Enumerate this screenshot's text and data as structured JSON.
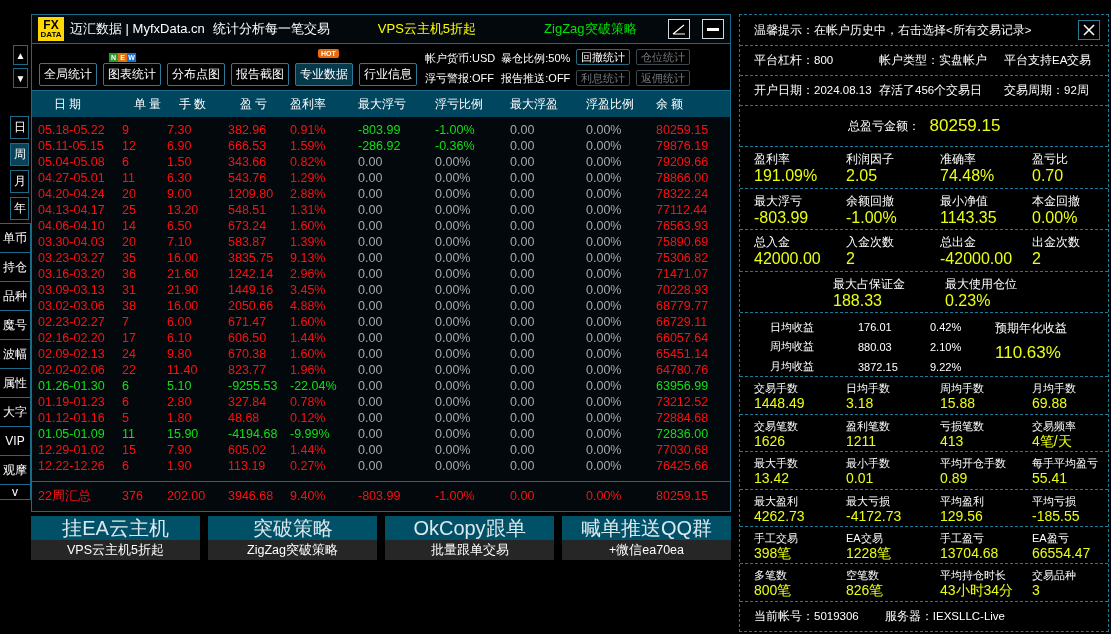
{
  "header": {
    "logo_top": "FX",
    "logo_bottom": "DATA",
    "title": "迈汇数据 | MyfxData.cn",
    "slogan": "统计分析每一笔交易",
    "promo_1": "VPS云主机5折起",
    "promo_2": "ZigZag突破策略"
  },
  "scroll_buttons": [
    "▲",
    "▼"
  ],
  "period_tabs": [
    {
      "label": "日",
      "selected": false
    },
    {
      "label": "周",
      "selected": true
    },
    {
      "label": "月",
      "selected": false
    },
    {
      "label": "年",
      "selected": false
    }
  ],
  "side_menu": [
    "单币",
    "持仓",
    "品种",
    "魔号",
    "波幅",
    "属性",
    "大字",
    "VIP",
    "观摩",
    "v"
  ],
  "toolbar": [
    {
      "label": "全局统计",
      "selected": false
    },
    {
      "label": "图表统计",
      "selected": false,
      "badge": {
        "kind": "new",
        "letters": [
          "N",
          "E",
          "W"
        ]
      }
    },
    {
      "label": "分布点图",
      "selected": false
    },
    {
      "label": "报告截图",
      "selected": false
    },
    {
      "label": "专业数据",
      "selected": true,
      "badge": {
        "kind": "hot",
        "text": "HOT"
      }
    },
    {
      "label": "行业信息",
      "selected": false
    }
  ],
  "account_info": [
    "帐户货币:USD",
    "暴仓比例:50%",
    "浮亏警报:OFF",
    "报告推送:OFF"
  ],
  "stat_buttons": [
    {
      "label": "回撤统计",
      "disabled": false
    },
    {
      "label": "仓位统计",
      "disabled": true
    },
    {
      "label": "利息统计",
      "disabled": true
    },
    {
      "label": "返佣统计",
      "disabled": true
    }
  ],
  "table": {
    "columns": [
      "日 期",
      "单 量",
      "手 数",
      "盈 亏",
      "盈利率",
      "最大浮亏",
      "浮亏比例",
      "最大浮盈",
      "浮盈比例",
      "余 额"
    ],
    "rows": [
      {
        "profit": true,
        "float_drawdown": true,
        "cells": [
          "05.18-05.22",
          "9",
          "7.30",
          "382.96",
          "0.91%",
          "-803.99",
          "-1.00%",
          "0.00",
          "0.00%",
          "80259.15"
        ]
      },
      {
        "profit": true,
        "float_drawdown": true,
        "cells": [
          "05.11-05.15",
          "12",
          "6.90",
          "666.53",
          "1.59%",
          "-286.92",
          "-0.36%",
          "0.00",
          "0.00%",
          "79876.19"
        ]
      },
      {
        "profit": true,
        "float_drawdown": false,
        "cells": [
          "05.04-05.08",
          "6",
          "1.50",
          "343.66",
          "0.82%",
          "0.00",
          "0.00%",
          "0.00",
          "0.00%",
          "79209.66"
        ]
      },
      {
        "profit": true,
        "float_drawdown": false,
        "cells": [
          "04.27-05.01",
          "11",
          "6.30",
          "543.76",
          "1.29%",
          "0.00",
          "0.00%",
          "0.00",
          "0.00%",
          "78866.00"
        ]
      },
      {
        "profit": true,
        "float_drawdown": false,
        "cells": [
          "04.20-04.24",
          "20",
          "9.00",
          "1209.80",
          "2.88%",
          "0.00",
          "0.00%",
          "0.00",
          "0.00%",
          "78322.24"
        ]
      },
      {
        "profit": true,
        "float_drawdown": false,
        "cells": [
          "04.13-04.17",
          "25",
          "13.20",
          "548.51",
          "1.31%",
          "0.00",
          "0.00%",
          "0.00",
          "0.00%",
          "77112.44"
        ]
      },
      {
        "profit": true,
        "float_drawdown": false,
        "cells": [
          "04.06-04.10",
          "14",
          "6.50",
          "673.24",
          "1.60%",
          "0.00",
          "0.00%",
          "0.00",
          "0.00%",
          "76563.93"
        ]
      },
      {
        "profit": true,
        "float_drawdown": false,
        "cells": [
          "03.30-04.03",
          "20",
          "7.10",
          "583.87",
          "1.39%",
          "0.00",
          "0.00%",
          "0.00",
          "0.00%",
          "75890.69"
        ]
      },
      {
        "profit": true,
        "float_drawdown": false,
        "cells": [
          "03.23-03.27",
          "35",
          "16.00",
          "3835.75",
          "9.13%",
          "0.00",
          "0.00%",
          "0.00",
          "0.00%",
          "75306.82"
        ]
      },
      {
        "profit": true,
        "float_drawdown": false,
        "cells": [
          "03.16-03.20",
          "36",
          "21.60",
          "1242.14",
          "2.96%",
          "0.00",
          "0.00%",
          "0.00",
          "0.00%",
          "71471.07"
        ]
      },
      {
        "profit": true,
        "float_drawdown": false,
        "cells": [
          "03.09-03.13",
          "31",
          "21.90",
          "1449.16",
          "3.45%",
          "0.00",
          "0.00%",
          "0.00",
          "0.00%",
          "70228.93"
        ]
      },
      {
        "profit": true,
        "float_drawdown": false,
        "cells": [
          "03.02-03.06",
          "38",
          "16.00",
          "2050.66",
          "4.88%",
          "0.00",
          "0.00%",
          "0.00",
          "0.00%",
          "68779.77"
        ]
      },
      {
        "profit": true,
        "float_drawdown": false,
        "cells": [
          "02.23-02.27",
          "7",
          "6.00",
          "671.47",
          "1.60%",
          "0.00",
          "0.00%",
          "0.00",
          "0.00%",
          "66729.11"
        ]
      },
      {
        "profit": true,
        "float_drawdown": false,
        "cells": [
          "02.16-02.20",
          "17",
          "6.10",
          "606.50",
          "1.44%",
          "0.00",
          "0.00%",
          "0.00",
          "0.00%",
          "66057.64"
        ]
      },
      {
        "profit": true,
        "float_drawdown": false,
        "cells": [
          "02.09-02.13",
          "24",
          "9.80",
          "670.38",
          "1.60%",
          "0.00",
          "0.00%",
          "0.00",
          "0.00%",
          "65451.14"
        ]
      },
      {
        "profit": true,
        "float_drawdown": false,
        "cells": [
          "02.02-02.06",
          "22",
          "11.40",
          "823.77",
          "1.96%",
          "0.00",
          "0.00%",
          "0.00",
          "0.00%",
          "64780.76"
        ]
      },
      {
        "profit": false,
        "float_drawdown": false,
        "cells": [
          "01.26-01.30",
          "6",
          "5.10",
          "-9255.53",
          "-22.04%",
          "0.00",
          "0.00%",
          "0.00",
          "0.00%",
          "63956.99"
        ]
      },
      {
        "profit": true,
        "float_drawdown": false,
        "cells": [
          "01.19-01.23",
          "6",
          "2.80",
          "327.84",
          "0.78%",
          "0.00",
          "0.00%",
          "0.00",
          "0.00%",
          "73212.52"
        ]
      },
      {
        "profit": true,
        "float_drawdown": false,
        "cells": [
          "01.12-01.16",
          "5",
          "1.80",
          "48.68",
          "0.12%",
          "0.00",
          "0.00%",
          "0.00",
          "0.00%",
          "72884.68"
        ]
      },
      {
        "profit": false,
        "float_drawdown": false,
        "cells": [
          "01.05-01.09",
          "11",
          "15.90",
          "-4194.68",
          "-9.99%",
          "0.00",
          "0.00%",
          "0.00",
          "0.00%",
          "72836.00"
        ]
      },
      {
        "profit": true,
        "float_drawdown": false,
        "cells": [
          "12.29-01.02",
          "15",
          "7.90",
          "605.02",
          "1.44%",
          "0.00",
          "0.00%",
          "0.00",
          "0.00%",
          "77030.68"
        ]
      },
      {
        "profit": true,
        "float_drawdown": false,
        "cells": [
          "12.22-12.26",
          "6",
          "1.90",
          "113.19",
          "0.27%",
          "0.00",
          "0.00%",
          "0.00",
          "0.00%",
          "76425.66"
        ]
      }
    ],
    "summary": {
      "profit": true,
      "cells": [
        "22周汇总",
        "376",
        "202.00",
        "3946.68",
        "9.40%",
        "-803.99",
        "-1.00%",
        "0.00",
        "0.00%",
        "80259.15"
      ]
    }
  },
  "banners": [
    {
      "title": "挂EA云主机",
      "subtitle": "VPS云主机5折起"
    },
    {
      "title": "突破策略",
      "subtitle": "ZigZag突破策略"
    },
    {
      "title": "OkCopy跟单",
      "subtitle": "批量跟单交易"
    },
    {
      "title": "喊单推送QQ群",
      "subtitle": "+微信ea70ea"
    }
  ],
  "right": {
    "hint": "温馨提示：在帐户历史中，右击选择<所有交易记录>",
    "info_rows": [
      [
        "平台杠杆：800",
        "帐户类型：实盘帐户",
        "平台支持EA交易"
      ],
      [
        "开户日期：2024.08.13",
        "存活了456个交易日",
        "交易周期：92周"
      ]
    ],
    "total": {
      "label": "总盈亏金额：",
      "value": "80259.15"
    },
    "sections": [
      {
        "kind": "grid",
        "items": [
          {
            "label": "盈利率",
            "value": "191.09%"
          },
          {
            "label": "利润因子",
            "value": "2.05"
          },
          {
            "label": "准确率",
            "value": "74.48%"
          },
          {
            "label": "盈亏比",
            "value": "0.70"
          }
        ]
      },
      {
        "kind": "grid",
        "items": [
          {
            "label": "最大浮亏",
            "value": "-803.99"
          },
          {
            "label": "余额回撤",
            "value": "-1.00%"
          },
          {
            "label": "最小净值",
            "value": "1143.35"
          },
          {
            "label": "本金回撤",
            "value": "0.00%"
          }
        ]
      },
      {
        "kind": "grid",
        "items": [
          {
            "label": "总入金",
            "value": "42000.00"
          },
          {
            "label": "入金次数",
            "value": "2"
          },
          {
            "label": "总出金",
            "value": "-42000.00"
          },
          {
            "label": "出金次数",
            "value": "2"
          }
        ]
      },
      {
        "kind": "pair",
        "items": [
          {
            "label": "最大占保证金",
            "value": "188.33"
          },
          {
            "label": "最大使用仓位",
            "value": "0.23%"
          }
        ]
      },
      {
        "kind": "average",
        "rows": [
          [
            "日均收益",
            "176.01",
            "0.42%"
          ],
          [
            "周均收益",
            "880.03",
            "2.10%"
          ],
          [
            "月均收益",
            "3872.15",
            "9.22%"
          ]
        ],
        "annual": {
          "label": "预期年化收益",
          "value": "110.63%"
        }
      },
      {
        "kind": "small",
        "items": [
          {
            "label": "交易手数",
            "value": "1448.49"
          },
          {
            "label": "日均手数",
            "value": "3.18"
          },
          {
            "label": "周均手数",
            "value": "15.88"
          },
          {
            "label": "月均手数",
            "value": "69.88"
          }
        ]
      },
      {
        "kind": "small",
        "items": [
          {
            "label": "交易笔数",
            "value": "1626"
          },
          {
            "label": "盈利笔数",
            "value": "1211"
          },
          {
            "label": "亏损笔数",
            "value": "413"
          },
          {
            "label": "交易频率",
            "value": "4笔/天"
          }
        ]
      },
      {
        "kind": "small",
        "items": [
          {
            "label": "最大手数",
            "value": "13.42"
          },
          {
            "label": "最小手数",
            "value": "0.01"
          },
          {
            "label": "平均开仓手数",
            "value": "0.89"
          },
          {
            "label": "每手平均盈亏",
            "value": "55.41"
          }
        ]
      },
      {
        "kind": "small",
        "items": [
          {
            "label": "最大盈利",
            "value": "4262.73"
          },
          {
            "label": "最大亏损",
            "value": "-4172.73"
          },
          {
            "label": "平均盈利",
            "value": "129.56"
          },
          {
            "label": "平均亏损",
            "value": "-185.55"
          }
        ]
      },
      {
        "kind": "small",
        "items": [
          {
            "label": "手工交易",
            "value": "398笔"
          },
          {
            "label": "EA交易",
            "value": "1228笔"
          },
          {
            "label": "手工盈亏",
            "value": "13704.68"
          },
          {
            "label": "EA盈亏",
            "value": "66554.47"
          }
        ]
      },
      {
        "kind": "small",
        "items": [
          {
            "label": "多笔数",
            "value": "800笔"
          },
          {
            "label": "空笔数",
            "value": "826笔"
          },
          {
            "label": "平均持仓时长",
            "value": "43小时34分"
          },
          {
            "label": "交易品种",
            "value": "3"
          }
        ]
      }
    ],
    "footer": [
      "当前帐号：5019306",
      "服务器：IEXSLLC-Live"
    ]
  }
}
